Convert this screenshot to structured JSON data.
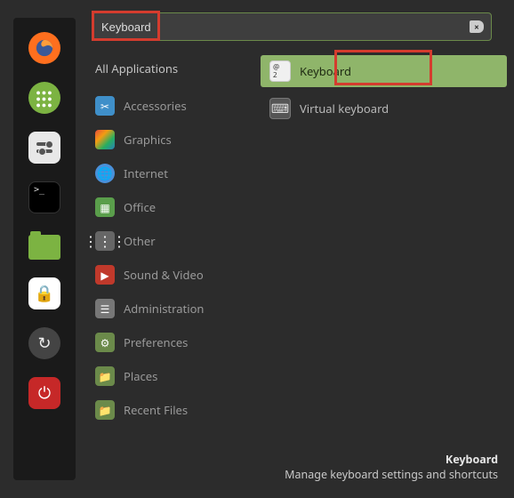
{
  "launcher": [
    {
      "name": "firefox",
      "glyph": ""
    },
    {
      "name": "apps",
      "glyph": "⋮⋮⋮"
    },
    {
      "name": "settings",
      "glyph": ""
    },
    {
      "name": "terminal",
      "glyph": ""
    },
    {
      "name": "files",
      "glyph": ""
    },
    {
      "name": "lock",
      "glyph": "🔒"
    },
    {
      "name": "update",
      "glyph": "↻"
    },
    {
      "name": "power",
      "glyph": "⏻"
    }
  ],
  "search": {
    "value": "Keyboard",
    "clear_glyph": "×"
  },
  "categories": {
    "heading": "All Applications",
    "items": [
      {
        "label": "Accessories",
        "icon": "✂"
      },
      {
        "label": "Graphics",
        "icon": ""
      },
      {
        "label": "Internet",
        "icon": "🌐"
      },
      {
        "label": "Office",
        "icon": "▦"
      },
      {
        "label": "Other",
        "icon": "⋮⋮"
      },
      {
        "label": "Sound & Video",
        "icon": "▶"
      },
      {
        "label": "Administration",
        "icon": "☰"
      },
      {
        "label": "Preferences",
        "icon": "⚙"
      },
      {
        "label": "Places",
        "icon": "📁"
      },
      {
        "label": "Recent Files",
        "icon": "📁"
      }
    ]
  },
  "results": [
    {
      "label": "Keyboard",
      "active": true
    },
    {
      "label": "Virtual keyboard",
      "active": false
    }
  ],
  "footer": {
    "title": "Keyboard",
    "desc": "Manage keyboard settings and shortcuts"
  }
}
